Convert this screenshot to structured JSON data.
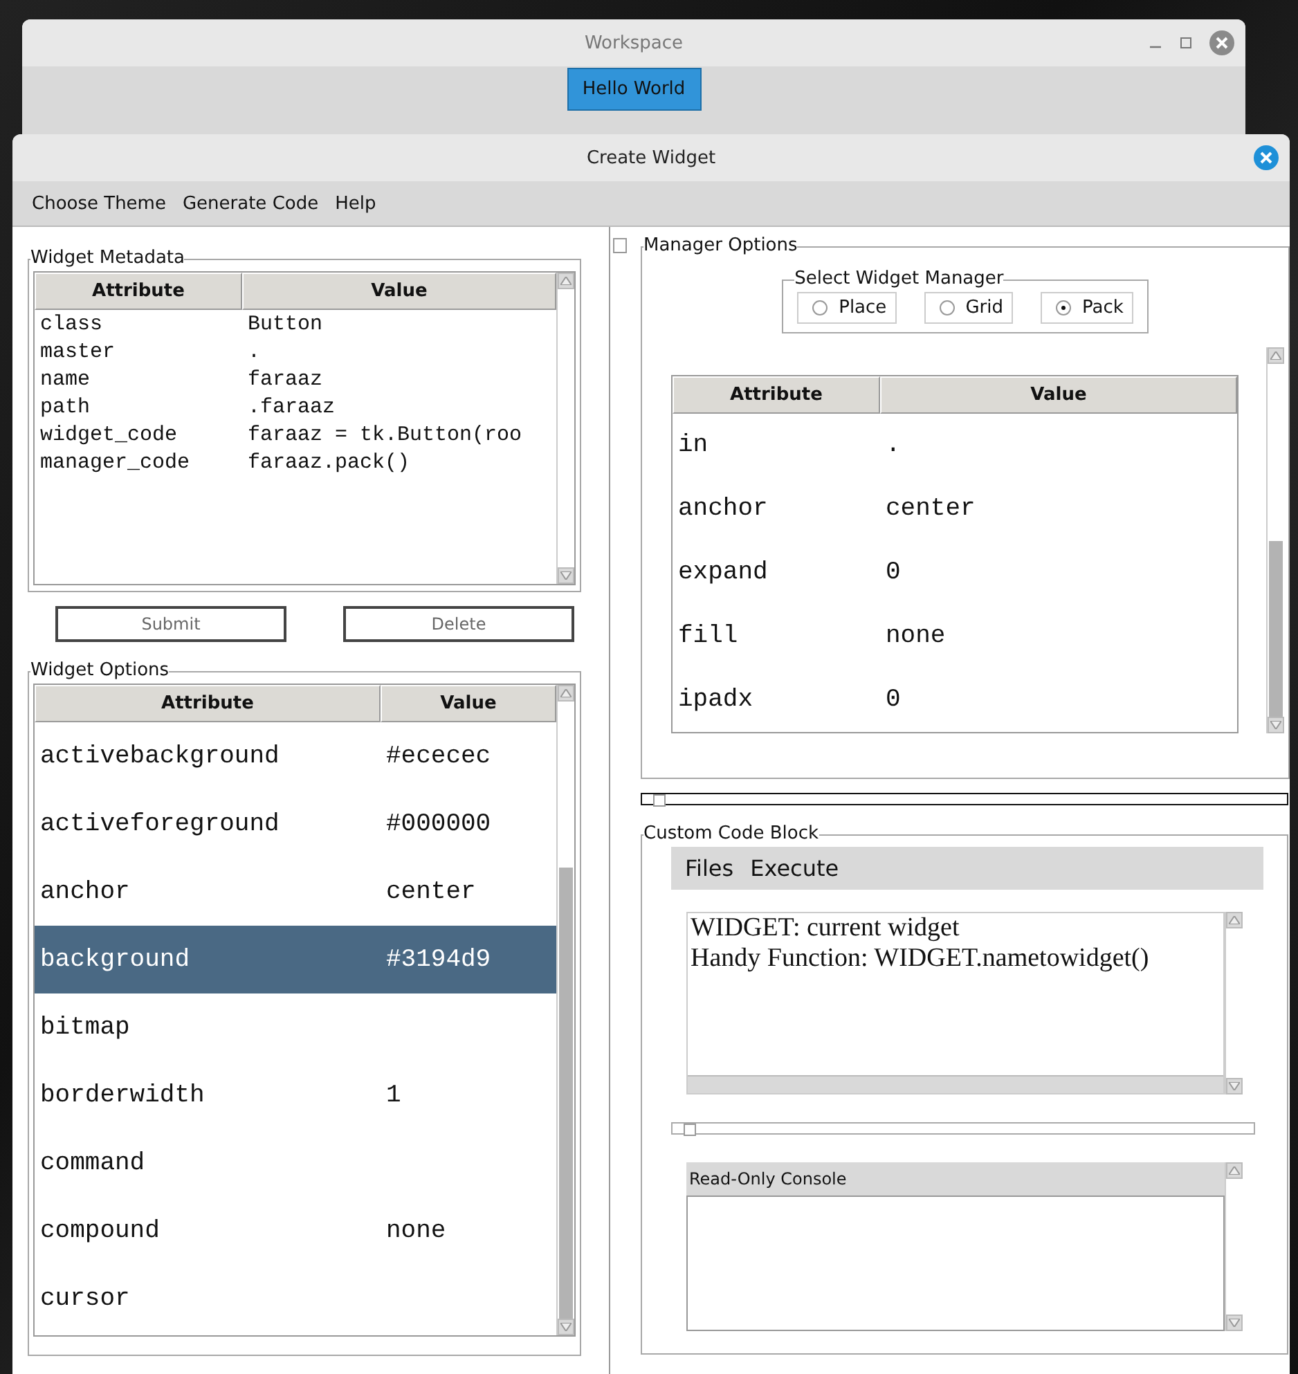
{
  "workspace": {
    "title": "Workspace",
    "button": "Hello World"
  },
  "dialog": {
    "title": "Create Widget",
    "menu": [
      "Choose Theme",
      "Generate Code",
      "Help"
    ]
  },
  "widget_metadata": {
    "title": "Widget Metadata",
    "columns": [
      "Attribute",
      "Value"
    ],
    "rows": [
      {
        "attribute": "class",
        "value": "Button"
      },
      {
        "attribute": "master",
        "value": "."
      },
      {
        "attribute": "name",
        "value": "faraaz"
      },
      {
        "attribute": "path",
        "value": ".faraaz"
      },
      {
        "attribute": "widget_code",
        "value": "faraaz = tk.Button(roo"
      },
      {
        "attribute": "manager_code",
        "value": "faraaz.pack()"
      }
    ]
  },
  "actions": [
    "Submit",
    "Delete"
  ],
  "widget_options": {
    "title": "Widget Options",
    "columns": [
      "Attribute",
      "Value"
    ],
    "rows": [
      {
        "attribute": "activebackground",
        "value": "#ececec",
        "selected": false
      },
      {
        "attribute": "activeforeground",
        "value": "#000000",
        "selected": false
      },
      {
        "attribute": "anchor",
        "value": "center",
        "selected": false
      },
      {
        "attribute": "background",
        "value": "#3194d9",
        "selected": true
      },
      {
        "attribute": "bitmap",
        "selected": false
      },
      {
        "attribute": "borderwidth",
        "value": "1",
        "selected": false
      },
      {
        "attribute": "command",
        "selected": false
      },
      {
        "attribute": "compound",
        "value": "none",
        "selected": false
      },
      {
        "attribute": "cursor",
        "selected": false
      }
    ]
  },
  "manager_options": {
    "title": "Manager Options",
    "selector": {
      "title": "Select Widget Manager",
      "options": [
        {
          "label": "Place",
          "selected": false
        },
        {
          "label": "Grid",
          "selected": false
        },
        {
          "label": "Pack",
          "selected": true
        }
      ]
    },
    "columns": [
      "Attribute",
      "Value"
    ],
    "rows": [
      {
        "attribute": "in",
        "value": "."
      },
      {
        "attribute": "anchor",
        "value": "center"
      },
      {
        "attribute": "expand",
        "value": "0"
      },
      {
        "attribute": "fill",
        "value": "none"
      },
      {
        "attribute": "ipadx",
        "value": "0"
      }
    ]
  },
  "custom_code": {
    "title": "Custom Code Block",
    "menu": [
      "Files",
      "Execute"
    ],
    "code": "WIDGET: current widget\nHandy Function: WIDGET.nametowidget()",
    "console": {
      "title": "Read-Only Console"
    }
  }
}
